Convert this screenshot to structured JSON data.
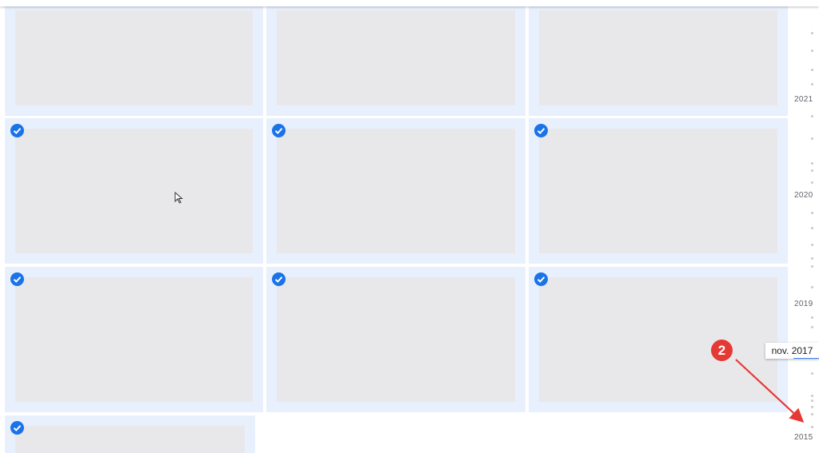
{
  "timeline": {
    "years": [
      "2021",
      "2020",
      "2019",
      "2015"
    ],
    "hover_label": "nov. 2017"
  },
  "annotation": {
    "step_number": "2",
    "color": "#e53935"
  },
  "colors": {
    "selection_accent": "#1a73e8",
    "tile_selected_bg": "#e8f0fe",
    "thumb_placeholder": "#e8e8ea"
  },
  "icons": {
    "checkmark": "check-circle-icon",
    "cursor": "mouse-pointer-icon"
  }
}
